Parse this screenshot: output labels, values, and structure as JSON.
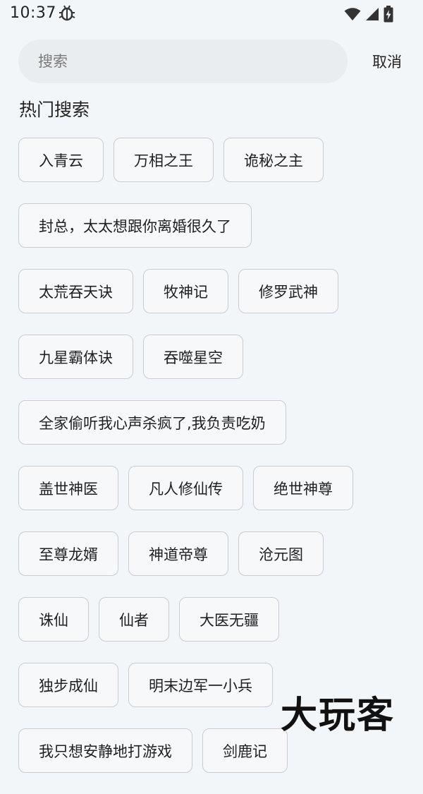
{
  "status_bar": {
    "time": "10:37",
    "app_icon": "bug-icon",
    "wifi_icon": "wifi-icon",
    "signal_icon": "cell-signal-icon",
    "battery_icon": "battery-charging-icon"
  },
  "search": {
    "placeholder": "搜索",
    "value": "",
    "cancel_label": "取消",
    "background_color": "#eaedf0"
  },
  "hot_search": {
    "title": "热门搜索",
    "rows": [
      [
        "入青云",
        "万相之王",
        "诡秘之主"
      ],
      [
        "封总，太太想跟你离婚很久了"
      ],
      [
        "太荒吞天诀",
        "牧神记",
        "修罗武神"
      ],
      [
        "九星霸体诀",
        "吞噬星空"
      ],
      [
        "全家偷听我心声杀疯了,我负责吃奶"
      ],
      [
        "盖世神医",
        "凡人修仙传",
        "绝世神尊"
      ],
      [
        "至尊龙婿",
        "神道帝尊",
        "沧元图"
      ],
      [
        "诛仙",
        "仙者",
        "大医无疆"
      ],
      [
        "独步成仙",
        "明末边军一小兵"
      ],
      [
        "我只想安静地打游戏",
        "剑鹿记"
      ]
    ]
  },
  "watermark": {
    "text": "大玩客"
  }
}
